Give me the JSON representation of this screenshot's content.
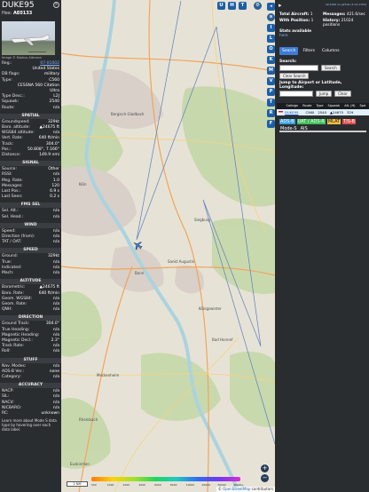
{
  "aircraft": {
    "callsign": "DUKE95",
    "hex_label": "Hex:",
    "hex": "AE0133",
    "photo_credit": "Image © Markus Altmann"
  },
  "details": [
    {
      "k": "Reg.:",
      "v": "07-01002",
      "link": true
    },
    {
      "k": "",
      "v": "United States"
    },
    {
      "k": "DB flags:",
      "v": "military"
    },
    {
      "k": "Type:",
      "v": "C560"
    },
    {
      "k": "",
      "v": "CESSNA 560 Citation"
    },
    {
      "k": "",
      "v": "Ultra"
    },
    {
      "k": "Type Desc.:",
      "v": "L2J"
    },
    {
      "k": "Squawk:",
      "v": "2540"
    },
    {
      "k": "Route:",
      "v": "n/a"
    }
  ],
  "sections": [
    {
      "title": "SPATIAL",
      "rows": [
        {
          "k": "Groundspeed:",
          "v": "329kt"
        },
        {
          "k": "Baro. altitude:",
          "v": "▲24675 ft"
        },
        {
          "k": "WGS84 altitude:",
          "v": "n/a"
        },
        {
          "k": "Vert. Rate:",
          "v": "640 ft/min"
        },
        {
          "k": "Track:",
          "v": "304.0°"
        },
        {
          "k": "Pos.:",
          "v": "50.808°, 7.166°"
        },
        {
          "k": "Distance:",
          "v": "149.9 nmi"
        }
      ]
    },
    {
      "title": "SIGNAL",
      "rows": [
        {
          "k": "Source:",
          "v": "Other"
        },
        {
          "k": "RSSI:",
          "v": "n/a"
        },
        {
          "k": "Msg. Rate:",
          "v": "1.0"
        },
        {
          "k": "Messages:",
          "v": "120"
        },
        {
          "k": "Last Pos.:",
          "v": "6.9 s"
        },
        {
          "k": "Last Seen:",
          "v": "0.2 s"
        }
      ]
    },
    {
      "title": "FMS SEL",
      "rows": [
        {
          "k": "Sel. Alt.:",
          "v": "n/a"
        },
        {
          "k": "Sel. Head.:",
          "v": "n/a"
        }
      ]
    },
    {
      "title": "WIND",
      "rows": [
        {
          "k": "Speed:",
          "v": "n/a"
        },
        {
          "k": "Direction (from):",
          "v": "n/a"
        },
        {
          "k": "TAT / OAT:",
          "v": "n/a"
        }
      ]
    },
    {
      "title": "SPEED",
      "rows": [
        {
          "k": "Ground:",
          "v": "329kt"
        },
        {
          "k": "True:",
          "v": "n/a"
        },
        {
          "k": "Indicated:",
          "v": "n/a"
        },
        {
          "k": "Mach:",
          "v": "n/a"
        }
      ]
    },
    {
      "title": "ALTITUDE",
      "rows": [
        {
          "k": "Barometric:",
          "v": "▲24675 ft"
        },
        {
          "k": "Baro. Rate:",
          "v": "640 ft/min"
        },
        {
          "k": "Geom. WGS84:",
          "v": "n/a"
        },
        {
          "k": "Geom. Rate:",
          "v": "n/a"
        },
        {
          "k": "QNH:",
          "v": "n/a"
        }
      ]
    },
    {
      "title": "DIRECTION",
      "rows": [
        {
          "k": "Ground Track:",
          "v": "304.0°"
        },
        {
          "k": "True Heading:",
          "v": "n/a"
        },
        {
          "k": "Magnetic Heading:",
          "v": "n/a"
        },
        {
          "k": "Magnetic Decl.:",
          "v": "2.3°"
        },
        {
          "k": "Track Rate:",
          "v": "n/a"
        },
        {
          "k": "Roll:",
          "v": "n/a"
        }
      ]
    },
    {
      "title": "STUFF",
      "rows": [
        {
          "k": "Nav. Modes:",
          "v": "n/a"
        },
        {
          "k": "ADS-B Ver.:",
          "v": "none"
        },
        {
          "k": "Category:",
          "v": "n/a"
        }
      ]
    },
    {
      "title": "ACCURACY",
      "rows": [
        {
          "k": "NACP:",
          "v": "n/a"
        },
        {
          "k": "SIL:",
          "v": "n/a"
        },
        {
          "k": "NACV:",
          "v": "n/a"
        },
        {
          "k": "NICBARO:",
          "v": "n/a"
        },
        {
          "k": "RC:",
          "v": "unknown"
        }
      ]
    }
  ],
  "footer_note": "Learn more about Mode S data type by hovering over each data label.",
  "map": {
    "top_buttons": [
      "U",
      "H",
      "T"
    ],
    "places": [
      "Bergisch Gladbach",
      "Köln",
      "Bonn",
      "Siegburg",
      "Sankt Augustin",
      "Königswinter",
      "Bad Honnef",
      "Meckenheim",
      "Rheinbach",
      "Euskirchen"
    ],
    "scale": "2 NM",
    "colorbar_labels": [
      "500",
      "1000",
      "2000",
      "4000",
      "6000",
      "8000",
      "10000",
      "20000",
      "30000",
      "40000+"
    ],
    "attribution_prefix": "©",
    "attribution_link": "OpenStreetMap",
    "attribution_suffix": "contributors",
    "zoom_in": "+",
    "zoom_out": "−"
  },
  "strip_buttons": [
    "◂",
    "⊙",
    "I",
    "L",
    "O",
    "K",
    "M",
    "V",
    "P",
    "T",
    "R",
    "F"
  ],
  "rightpanel": {
    "version": "tar1090 on github (3.14.1703)",
    "stats": {
      "total_aircraft_label": "Total Aircraft:",
      "total_aircraft": "1",
      "messages_label": "Messages:",
      "messages": "421.6/sec",
      "with_position_label": "With Position:",
      "with_position": "1",
      "history_label": "History:",
      "history": "21024 positions",
      "stats_label": "Stats available",
      "stats_link": "here"
    },
    "tabs": [
      "Search",
      "Filters",
      "Columns"
    ],
    "search_label": "Search:",
    "search_button": "Search",
    "clear_search_button": "Clear Search",
    "jump_label": "Jump to Airport or Latitude, Longitude:",
    "jump_button": "Jump",
    "clear_button": "Clear",
    "table_headers": [
      "",
      "Callsign",
      "Route",
      "Type",
      "Squawk",
      "Alt. (ft)",
      "Spd"
    ],
    "table_row": {
      "callsign": "DUKE95",
      "route": "",
      "type": "C560",
      "squawk": "2540",
      "alt": "▲24675",
      "spd": "329"
    },
    "source_flags": [
      "ADS-B",
      "UAT / ADS-R",
      "MLAT",
      "TIS-B",
      "Mode-S",
      "AIS"
    ]
  },
  "colors": {
    "panel_bg": "#2a2d30",
    "map_bg": "#e6e3d6",
    "accent": "#1c5fa8",
    "adsb": "#3a9fe0",
    "uat": "#3fbf58",
    "mlat": "#f0c040",
    "tisb": "#e05050"
  }
}
